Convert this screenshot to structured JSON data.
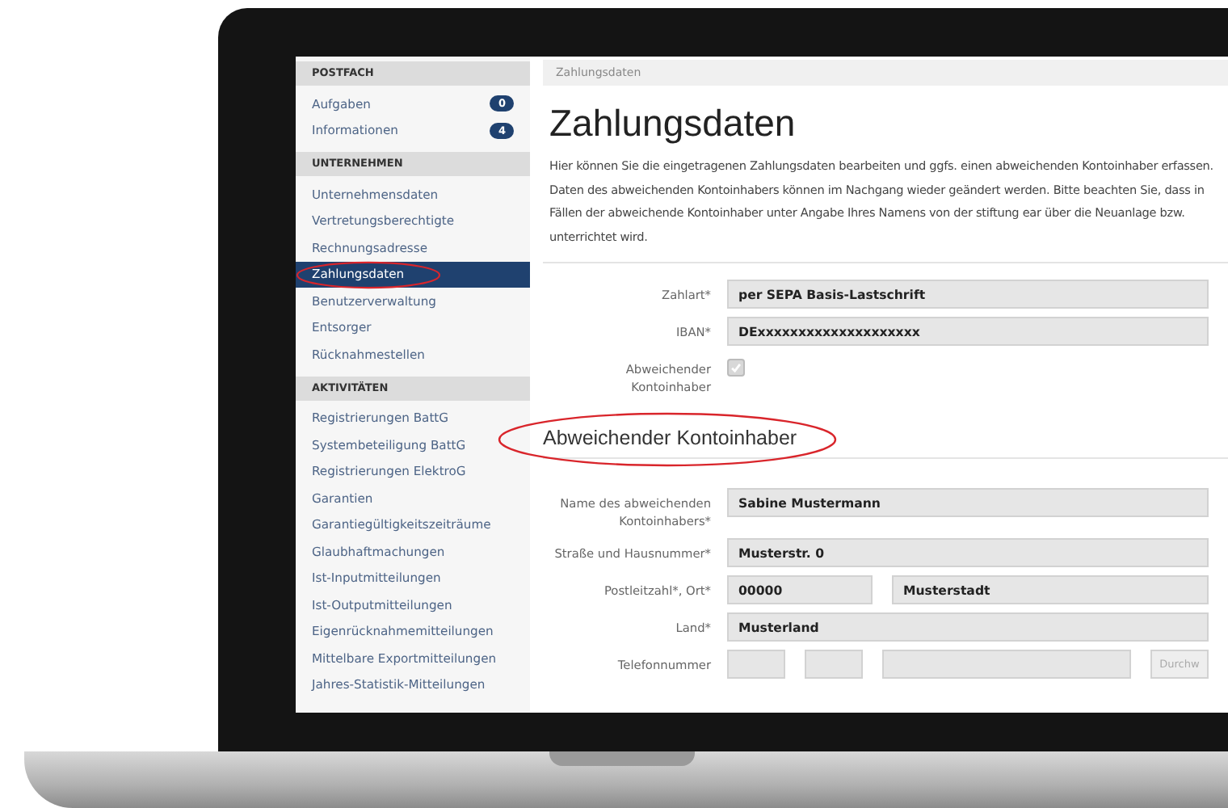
{
  "sidebar": {
    "groups": [
      {
        "title": "POSTFACH",
        "items": [
          {
            "label": "Aufgaben",
            "badge": "0",
            "selected": false
          },
          {
            "label": "Informationen",
            "badge": "4",
            "selected": false
          }
        ]
      },
      {
        "title": "UNTERNEHMEN",
        "items": [
          {
            "label": "Unternehmensdaten",
            "selected": false
          },
          {
            "label": "Vertretungsberechtigte",
            "selected": false
          },
          {
            "label": "Rechnungsadresse",
            "selected": false
          },
          {
            "label": "Zahlungsdaten",
            "selected": true
          },
          {
            "label": "Benutzerverwaltung",
            "selected": false
          },
          {
            "label": "Entsorger",
            "selected": false
          },
          {
            "label": "Rücknahmestellen",
            "selected": false
          }
        ]
      },
      {
        "title": "AKTIVITÄTEN",
        "items": [
          {
            "label": "Registrierungen BattG",
            "selected": false
          },
          {
            "label": "Systembeteiligung BattG",
            "selected": false
          },
          {
            "label": "Registrierungen ElektroG",
            "selected": false
          },
          {
            "label": "Garantien",
            "selected": false
          },
          {
            "label": "Garantiegültigkeitszeiträume",
            "selected": false
          },
          {
            "label": "Glaubhaftmachungen",
            "selected": false
          },
          {
            "label": "Ist-Inputmitteilungen",
            "selected": false
          },
          {
            "label": "Ist-Outputmitteilungen",
            "selected": false
          },
          {
            "label": "Eigenrücknahmemitteilungen",
            "selected": false
          },
          {
            "label": "Mittelbare Exportmitteilungen",
            "selected": false
          },
          {
            "label": "Jahres-Statistik-Mitteilungen",
            "selected": false
          }
        ]
      }
    ]
  },
  "breadcrumb": "Zahlungsdaten",
  "title": "Zahlungsdaten",
  "intro": "Hier können Sie die eingetragenen Zahlungsdaten bearbeiten und ggfs. einen abweichenden Kontoinhaber erfassen.\nDaten des abweichenden Kontoinhabers können im Nachgang wieder geändert werden. Bitte beachten Sie, dass in\nFällen der abweichende Kontoinhaber unter Angabe Ihres Namens von der stiftung ear über die Neuanlage bzw.\nunterrichtet wird.",
  "fields": [
    {
      "kind": "text",
      "label": "Zahlart*",
      "value": "per SEPA Basis-Lastschrift"
    },
    {
      "kind": "text",
      "label": "IBAN*",
      "value": "DExxxxxxxxxxxxxxxxxxxx"
    },
    {
      "kind": "checkbox",
      "label": "Abweichender\nKontoinhaber",
      "checked": true,
      "disabled": true
    }
  ],
  "section": {
    "title": "Abweichender Kontoinhaber",
    "fields": [
      {
        "kind": "text",
        "label": "Name des abweichenden\nKontoinhabers*",
        "value": "Sabine Mustermann"
      },
      {
        "kind": "text",
        "label": "Straße und Hausnummer*",
        "value": "Musterstr. 0"
      },
      {
        "kind": "split",
        "label": "Postleitzahl*, Ort*",
        "values": [
          "00000",
          "Musterstadt"
        ]
      },
      {
        "kind": "text",
        "label": "Land*",
        "value": "Musterland"
      },
      {
        "kind": "phone",
        "label": "Telefonnummer",
        "button": "Durchw"
      }
    ]
  }
}
